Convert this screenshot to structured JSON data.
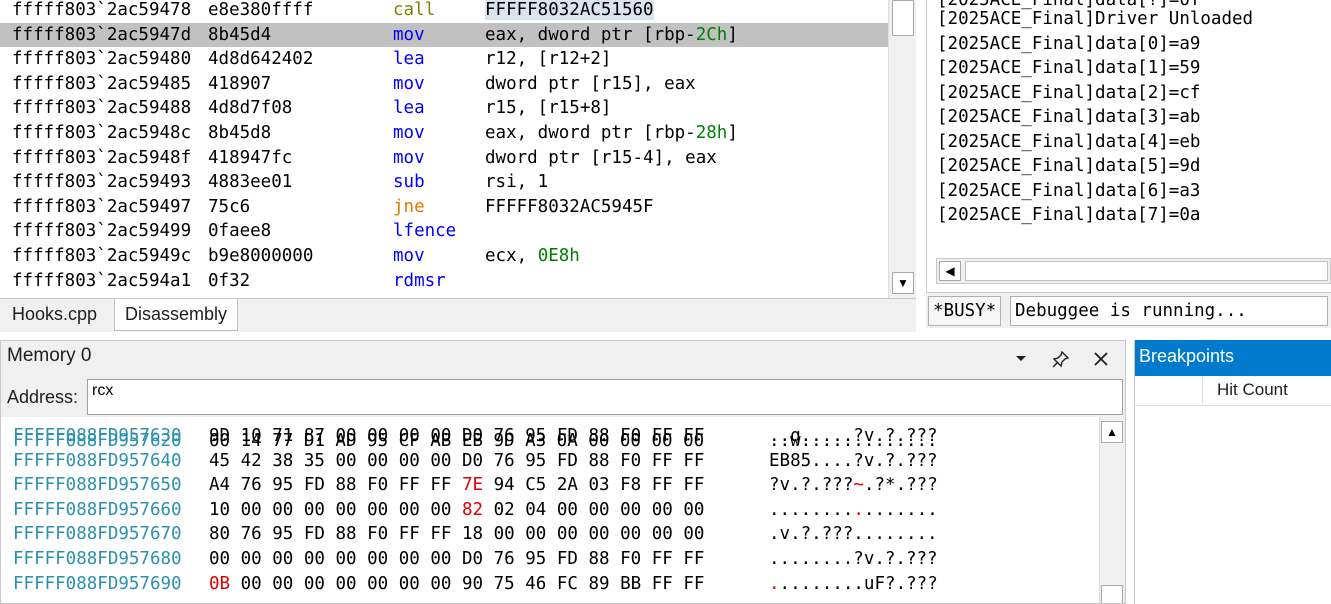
{
  "disassembly": {
    "rows": [
      {
        "addr": "fffff803`2ac59478",
        "bytes": "e8e380ffff",
        "mnemonic": "call",
        "operands": [
          {
            "t": "FFFFF8032AC51560",
            "c": "hl"
          }
        ]
      },
      {
        "addr": "fffff803`2ac5947d",
        "bytes": "8b45d4",
        "mnemonic": "mov",
        "selected": true,
        "operands": [
          {
            "t": "eax, dword ptr [rbp-"
          },
          {
            "t": "2Ch",
            "c": "num"
          },
          {
            "t": "]"
          }
        ]
      },
      {
        "addr": "fffff803`2ac59480",
        "bytes": "4d8d642402",
        "mnemonic": "lea",
        "operands": [
          {
            "t": "r12, [r12+2]"
          }
        ]
      },
      {
        "addr": "fffff803`2ac59485",
        "bytes": "418907",
        "mnemonic": "mov",
        "operands": [
          {
            "t": "dword ptr [r15], eax"
          }
        ]
      },
      {
        "addr": "fffff803`2ac59488",
        "bytes": "4d8d7f08",
        "mnemonic": "lea",
        "operands": [
          {
            "t": "r15, [r15+8]"
          }
        ]
      },
      {
        "addr": "fffff803`2ac5948c",
        "bytes": "8b45d8",
        "mnemonic": "mov",
        "operands": [
          {
            "t": "eax, dword ptr [rbp-"
          },
          {
            "t": "28h",
            "c": "num"
          },
          {
            "t": "]"
          }
        ]
      },
      {
        "addr": "fffff803`2ac5948f",
        "bytes": "418947fc",
        "mnemonic": "mov",
        "operands": [
          {
            "t": "dword ptr [r15-4], eax"
          }
        ]
      },
      {
        "addr": "fffff803`2ac59493",
        "bytes": "4883ee01",
        "mnemonic": "sub",
        "operands": [
          {
            "t": "rsi, 1"
          }
        ]
      },
      {
        "addr": "fffff803`2ac59497",
        "bytes": "75c6",
        "mnemonic": "jne",
        "operands": [
          {
            "t": "FFFFF8032AC5945F"
          }
        ]
      },
      {
        "addr": "fffff803`2ac59499",
        "bytes": "0faee8",
        "mnemonic": "lfence",
        "operands": []
      },
      {
        "addr": "fffff803`2ac5949c",
        "bytes": "b9e8000000",
        "mnemonic": "mov",
        "operands": [
          {
            "t": "ecx, "
          },
          {
            "t": "0E8h",
            "c": "num"
          }
        ]
      },
      {
        "addr": "fffff803`2ac594a1",
        "bytes": "0f32",
        "mnemonic": "rdmsr",
        "operands": []
      }
    ],
    "tabs": [
      "Hooks.cpp",
      "Disassembly"
    ],
    "active_tab": "Disassembly"
  },
  "output": {
    "lines": [
      "[2025ACE_Final]Driver Unloaded",
      "[2025ACE_Final]data[0]=a9",
      "[2025ACE_Final]data[1]=59",
      "[2025ACE_Final]data[2]=cf",
      "[2025ACE_Final]data[3]=ab",
      "[2025ACE_Final]data[4]=eb",
      "[2025ACE_Final]data[5]=9d",
      "[2025ACE_Final]data[6]=a3",
      "[2025ACE_Final]data[7]=0a"
    ]
  },
  "status": {
    "busy": "*BUSY*",
    "message": "Debuggee is running..."
  },
  "memory": {
    "title": "Memory 0",
    "address_label": "Address:",
    "address_value": "rcx",
    "rows": [
      {
        "addr": "FFFFF088FD957630",
        "hex": [
          "9D",
          "10",
          "71",
          "87",
          "00",
          "00",
          "00",
          "00",
          "D0",
          "76",
          "95",
          "FD",
          "88",
          "F0",
          "FF",
          "FF"
        ],
        "changed": [],
        "ascii": "..q.....?v.?.???"
      },
      {
        "addr": "FFFFF088FD957640",
        "hex": [
          "45",
          "42",
          "38",
          "35",
          "00",
          "00",
          "00",
          "00",
          "D0",
          "76",
          "95",
          "FD",
          "88",
          "F0",
          "FF",
          "FF"
        ],
        "changed": [],
        "ascii": "EB85....?v.?.???"
      },
      {
        "addr": "FFFFF088FD957650",
        "hex": [
          "A4",
          "76",
          "95",
          "FD",
          "88",
          "F0",
          "FF",
          "FF",
          "7E",
          "94",
          "C5",
          "2A",
          "03",
          "F8",
          "FF",
          "FF"
        ],
        "changed": [
          8
        ],
        "ascii": "?v.?.???~.?*.???"
      },
      {
        "addr": "FFFFF088FD957660",
        "hex": [
          "10",
          "00",
          "00",
          "00",
          "00",
          "00",
          "00",
          "00",
          "82",
          "02",
          "04",
          "00",
          "00",
          "00",
          "00",
          "00"
        ],
        "changed": [
          8
        ],
        "ascii": "................"
      },
      {
        "addr": "FFFFF088FD957670",
        "hex": [
          "80",
          "76",
          "95",
          "FD",
          "88",
          "F0",
          "FF",
          "FF",
          "18",
          "00",
          "00",
          "00",
          "00",
          "00",
          "00",
          "00"
        ],
        "changed": [],
        "ascii": ".v.?.???........"
      },
      {
        "addr": "FFFFF088FD957680",
        "hex": [
          "00",
          "00",
          "00",
          "00",
          "00",
          "00",
          "00",
          "00",
          "D0",
          "76",
          "95",
          "FD",
          "88",
          "F0",
          "FF",
          "FF"
        ],
        "changed": [],
        "ascii": "........?v.?.???"
      },
      {
        "addr": "FFFFF088FD957690",
        "hex": [
          "0B",
          "00",
          "00",
          "00",
          "00",
          "00",
          "00",
          "00",
          "90",
          "75",
          "46",
          "FC",
          "89",
          "BB",
          "FF",
          "FF"
        ],
        "changed": [
          0
        ],
        "ascii": ".........uF?.???"
      }
    ]
  },
  "breakpoints": {
    "title": "Breakpoints",
    "columns": [
      "Hit Count"
    ]
  }
}
